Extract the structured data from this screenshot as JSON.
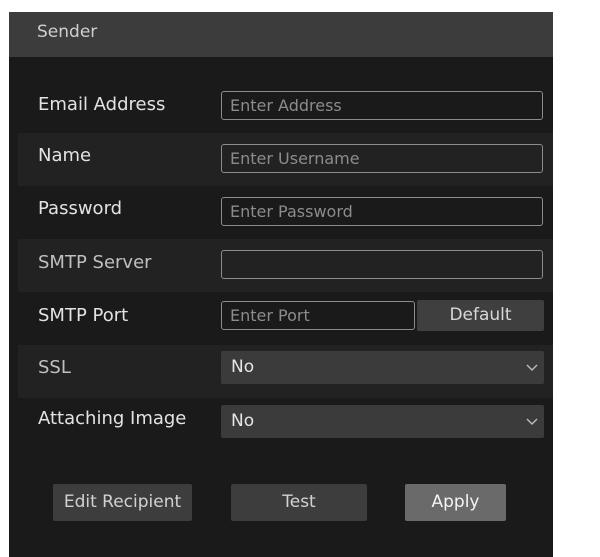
{
  "header": {
    "title": "Sender"
  },
  "form": {
    "email": {
      "label": "Email Address",
      "placeholder": "Enter Address",
      "value": ""
    },
    "name": {
      "label": "Name",
      "placeholder": "Enter Username",
      "value": ""
    },
    "password": {
      "label": "Password",
      "placeholder": "Enter Password",
      "value": ""
    },
    "smtp_server": {
      "label": "SMTP Server",
      "placeholder": "",
      "value": ""
    },
    "smtp_port": {
      "label": "SMTP Port",
      "placeholder": "Enter Port",
      "value": "",
      "default_label": "Default"
    },
    "ssl": {
      "label": "SSL",
      "value": "No"
    },
    "attaching_image": {
      "label": "Attaching Image",
      "value": "No"
    }
  },
  "actions": {
    "edit_recipient": "Edit Recipient",
    "test": "Test",
    "apply": "Apply"
  },
  "icons": {
    "dropdown": "chevron-down-icon"
  },
  "colors": {
    "panel_bg": "#1a1a1a",
    "header_bg": "#3c3c3c",
    "apply_bg": "#6a6a6a"
  }
}
